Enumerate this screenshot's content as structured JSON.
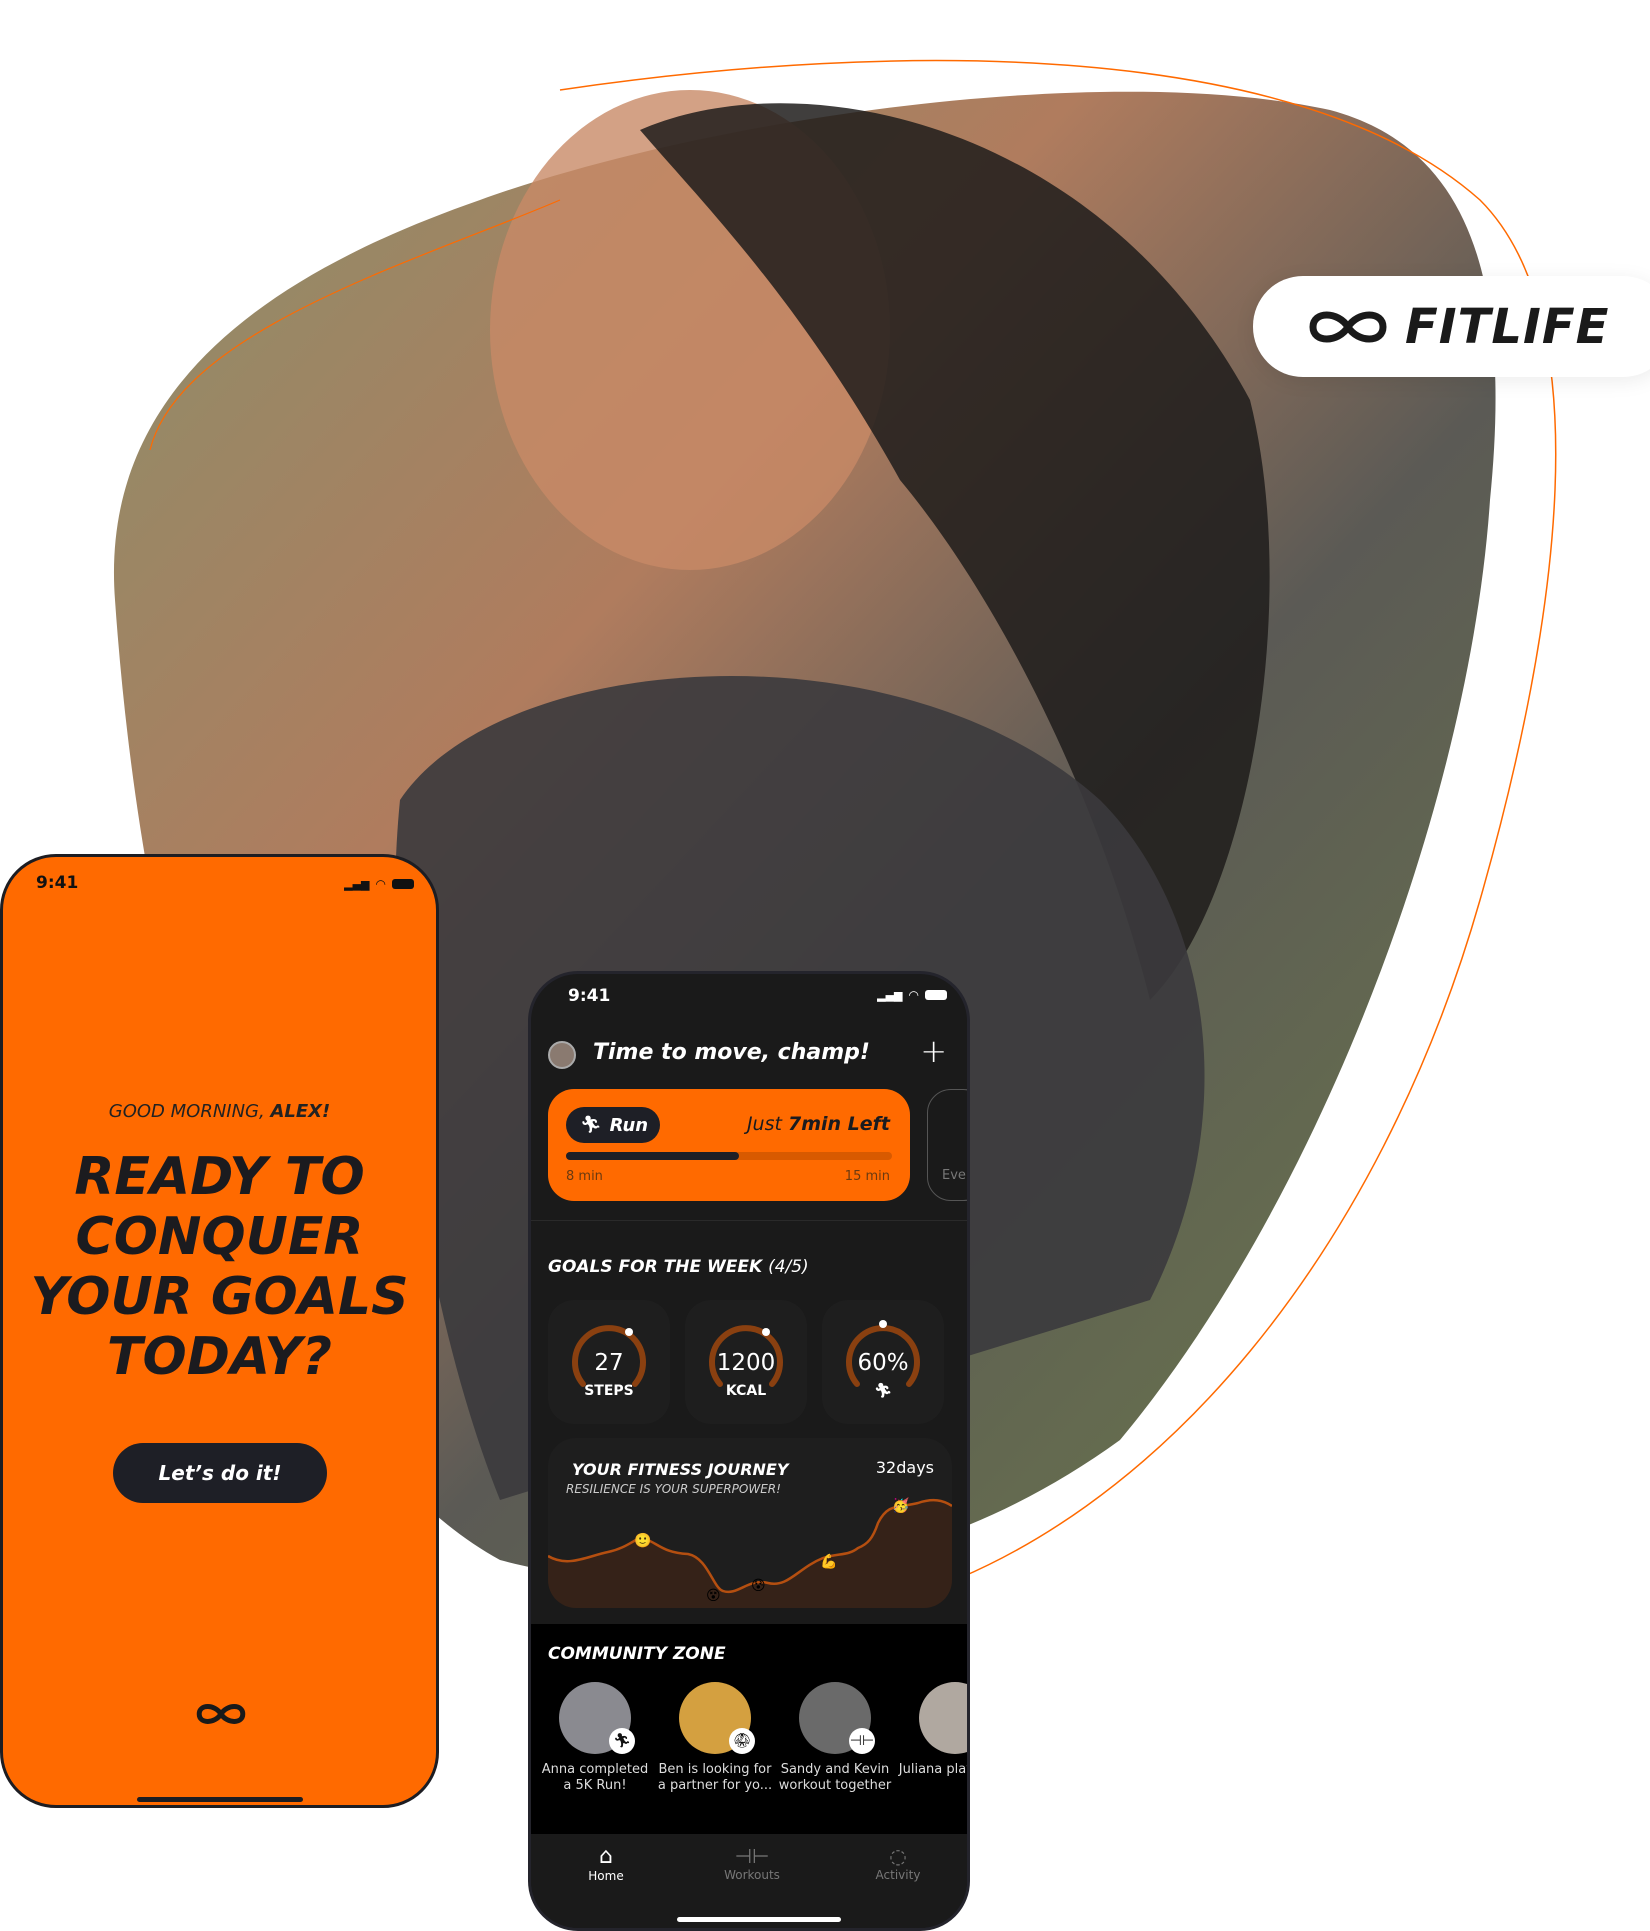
{
  "brand": {
    "name": "FITLIFE",
    "accent": "#ff6a00",
    "dark": "#1a1a1a"
  },
  "welcome": {
    "time": "9:41",
    "greeting": "GOOD MORNING, ",
    "name": "ALEX!",
    "headline": [
      "READY TO",
      "CONQUER",
      "YOUR GOALS",
      "TODAY?"
    ],
    "cta": "Let’s do it!"
  },
  "home": {
    "time": "9:41",
    "title": "Time to move, champ!",
    "activity": {
      "label": "Run",
      "remaining_prefix": "Just ",
      "remaining": "7min Left",
      "start": "8 min",
      "end": "15 min",
      "progress": 0.53,
      "next_card_label": "Eve"
    },
    "goals": {
      "title": "GOALS FOR THE WEEK",
      "count": "(4/5)",
      "items": [
        {
          "value": "27",
          "label": "STEPS"
        },
        {
          "value": "1200",
          "label": "KCAL"
        },
        {
          "value": "60%",
          "label": "run-icon"
        }
      ]
    },
    "journey": {
      "title": "YOUR FITNESS JOURNEY",
      "subtitle": "RESILIENCE IS YOUR SUPERPOWER!",
      "days": "32days"
    },
    "community": {
      "title": "COMMUNITY ZONE",
      "items": [
        {
          "caption": "Anna completed a 5K Run!",
          "icon": "run-icon"
        },
        {
          "caption": "Ben is looking for a partner for yo...",
          "icon": "kick-icon"
        },
        {
          "caption": "Sandy and Kevin workout together",
          "icon": "dumbbell-icon"
        },
        {
          "caption": "Juliana playing te",
          "icon": "tennis-icon"
        }
      ]
    },
    "nav": [
      {
        "label": "Home",
        "active": true
      },
      {
        "label": "Workouts",
        "active": false
      },
      {
        "label": "Activity",
        "active": false
      }
    ]
  }
}
